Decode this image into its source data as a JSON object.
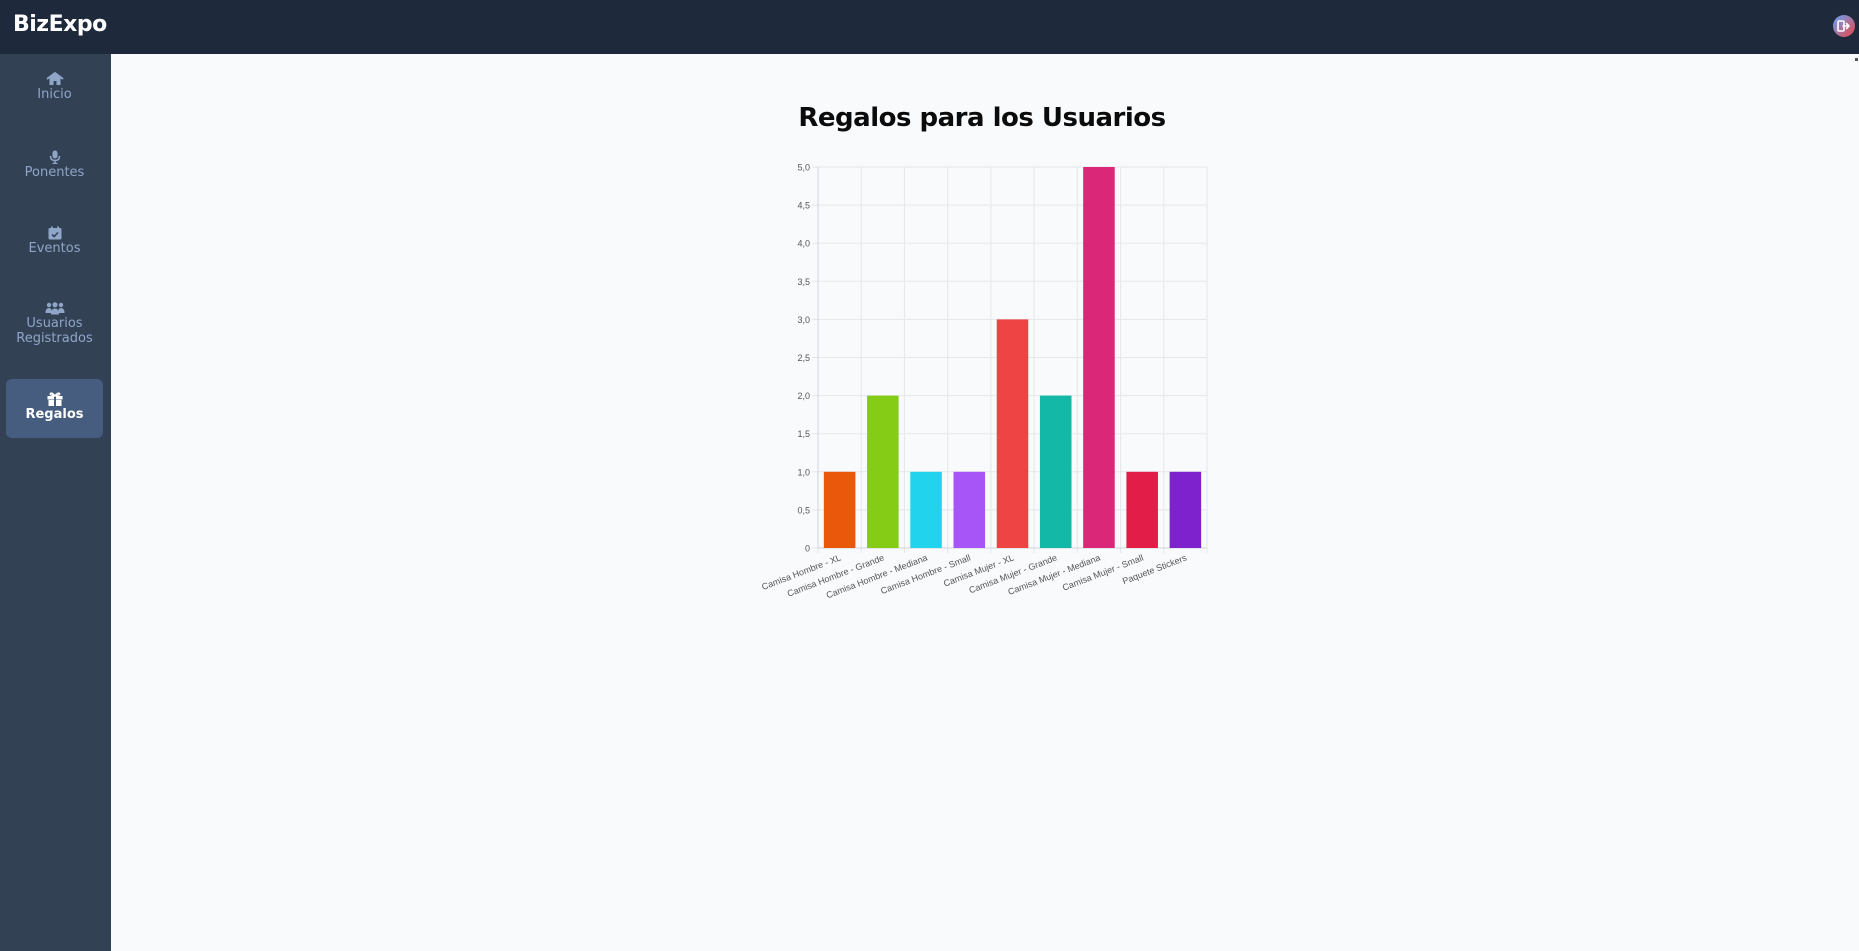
{
  "app": {
    "brand": "BizExpo"
  },
  "header": {
    "logout_icon": "logout-icon"
  },
  "sidebar": {
    "items": [
      {
        "label": "Inicio",
        "icon": "home-icon",
        "active": false
      },
      {
        "label": "Ponentes",
        "icon": "microphone-icon",
        "active": false
      },
      {
        "label": "Eventos",
        "icon": "calendar-check-icon",
        "active": false
      },
      {
        "label": "Usuarios\nRegistrados",
        "icon": "users-icon",
        "active": false
      },
      {
        "label": "Regalos",
        "icon": "gift-icon",
        "active": true
      }
    ]
  },
  "colors": {
    "topbar": "#1e293b",
    "sidebar": "#334155",
    "active": "#475d80",
    "background": "#f8fafc"
  },
  "chart_data": {
    "type": "bar",
    "title": "Regalos para los Usuarios",
    "categories": [
      "Camisa Hombre - XL",
      "Camisa Hombre - Grande",
      "Camisa Hombre - Mediana",
      "Camisa Hombre - Small",
      "Camisa Mujer - XL",
      "Camisa Mujer - Grande",
      "Camisa Mujer - Mediana",
      "Camisa Mujer - Small",
      "Paquete Stickers"
    ],
    "values": [
      1,
      2,
      1,
      1,
      3,
      2,
      5,
      1,
      1
    ],
    "colors": [
      "#ea580c",
      "#84cc16",
      "#22d3ee",
      "#a855f7",
      "#ef4444",
      "#14b8a6",
      "#db2777",
      "#e11d48",
      "#7e22ce"
    ],
    "ylim": [
      0,
      5
    ],
    "yticks": [
      "0",
      "0,5",
      "1,0",
      "1,5",
      "2,0",
      "2,5",
      "3,0",
      "3,5",
      "4,0",
      "4,5",
      "5,0"
    ],
    "grid": true,
    "legend": "none"
  }
}
